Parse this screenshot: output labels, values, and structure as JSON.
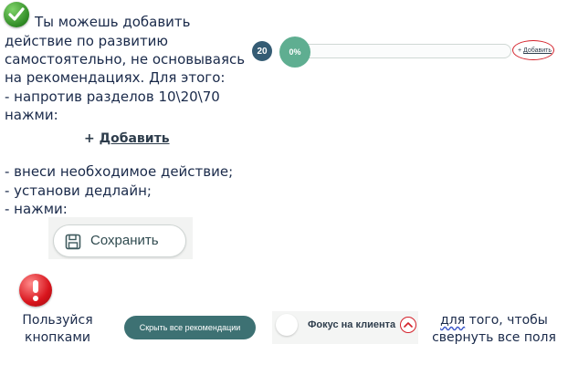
{
  "instructions": {
    "lines_part1": [
      "Ты можешь добавить",
      "действие по развитию",
      "самостоятельно, не основываясь",
      "на рекомендациях. Для этого:",
      "- напротив разделов 10\\20\\70",
      "нажми:"
    ],
    "add_link": {
      "plus": "+ ",
      "label": "Добавить"
    },
    "lines_part2": [
      "- внеси необходимое действие;",
      "- установи дедлайн;",
      "- нажми:"
    ],
    "save_button_label": "Сохранить"
  },
  "progress_row": {
    "number": "20",
    "percent_label": "0%",
    "progress_fraction": 0.0,
    "add_small": {
      "plus": "+ ",
      "label": "Добавить"
    },
    "accent": "#5fae91",
    "number_bg": "#355c74"
  },
  "bottom": {
    "use_text": [
      "Пользуйся",
      "кнопками"
    ],
    "hide_button_label": "Скрыть все рекомендации",
    "focus_label": "Фокус на клиента",
    "tip_word": "для",
    "tip_rest": " того, чтобы",
    "tip_line2": "свернуть все поля"
  },
  "colors": {
    "text": "#1a2a4a",
    "highlight_red": "#d4212a",
    "button_dark": "#3d7173"
  },
  "icons": [
    "checkmark-icon",
    "save-icon",
    "warning-icon",
    "chevron-up-icon"
  ]
}
